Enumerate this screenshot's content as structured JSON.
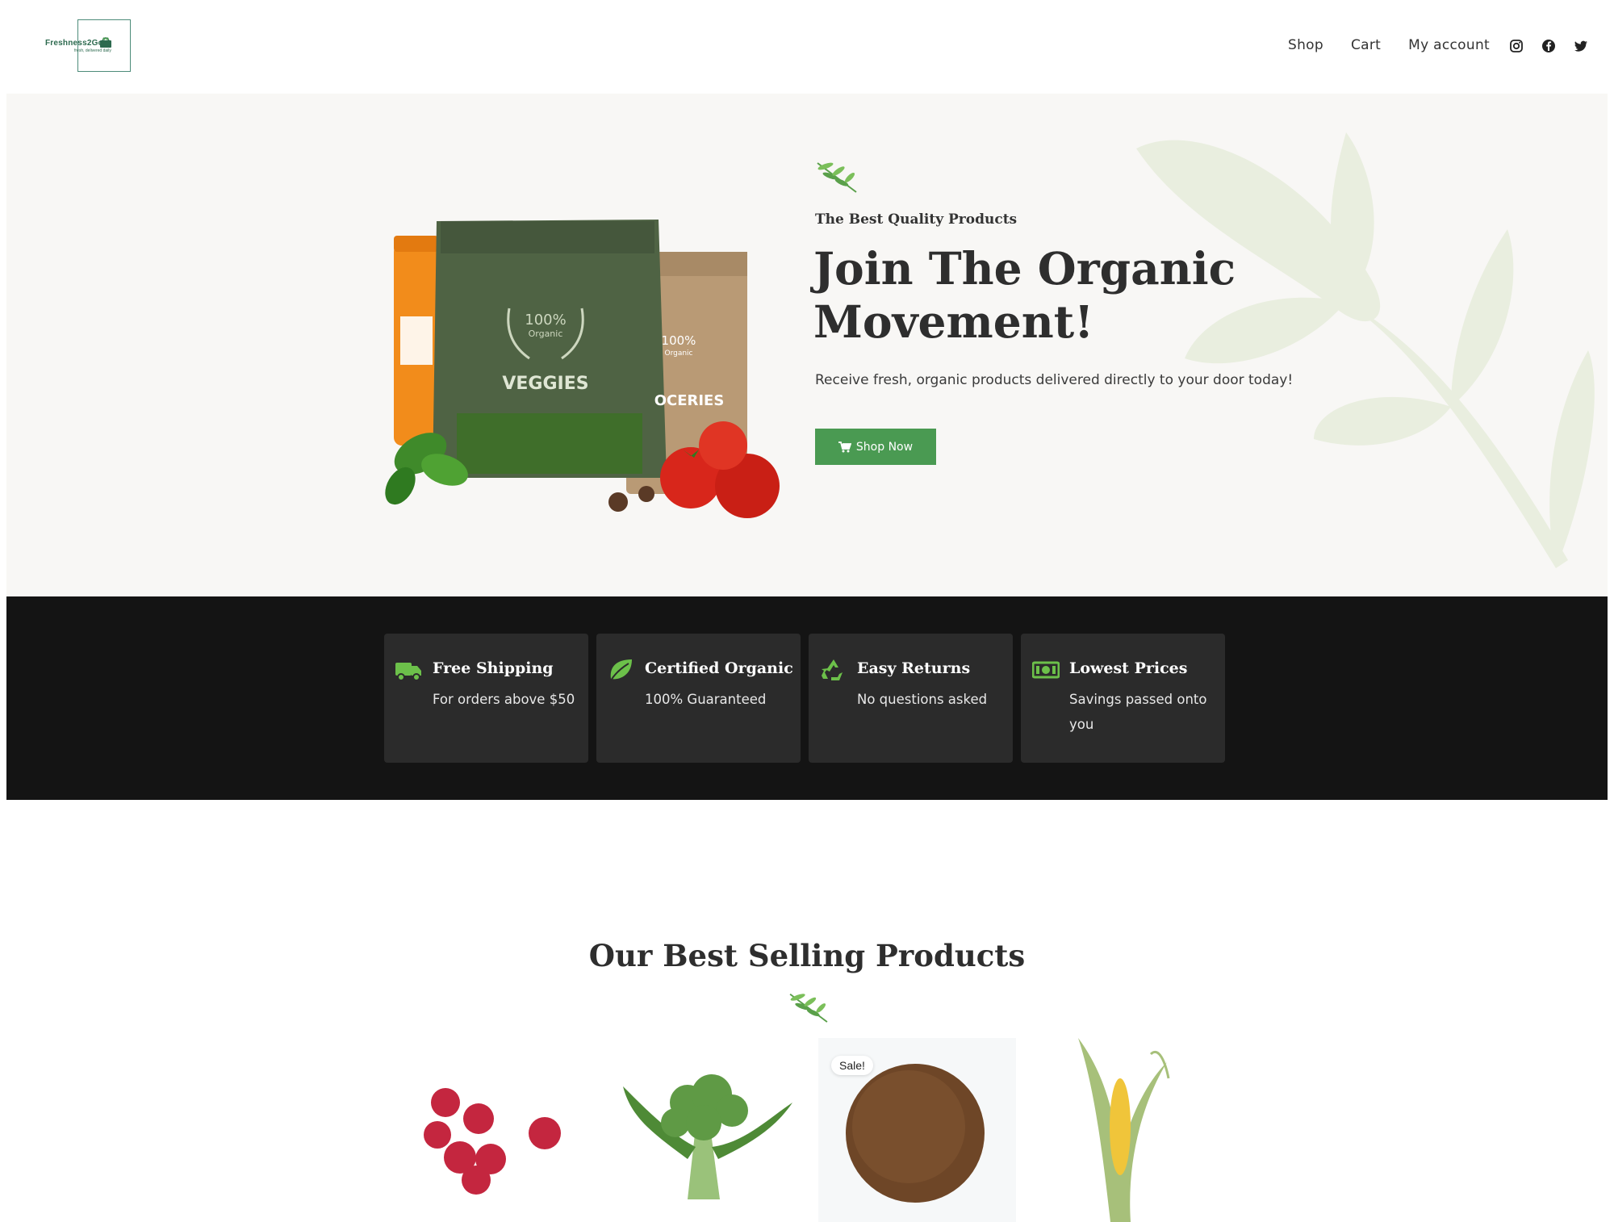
{
  "header": {
    "logo_text": "Freshness2Go",
    "logo_sub": "fresh, delivered daily",
    "nav": [
      {
        "label": "Shop"
      },
      {
        "label": "Cart"
      },
      {
        "label": "My account"
      }
    ],
    "social_icons": [
      "instagram-icon",
      "facebook-icon",
      "twitter-icon"
    ]
  },
  "hero": {
    "eyebrow": "The Best Quality Products",
    "title": "Join The Organic Movement!",
    "subtitle": "Receive fresh, organic products delivered directly to your door today!",
    "button_label": "Shop Now",
    "button_icon": "cart-icon",
    "accent_color": "#4a9a52",
    "bag_green_badge": "100%",
    "bag_green_badge_sub": "Organic",
    "bag_green_label": "VEGGIES",
    "bag_brown_badge": "100%",
    "bag_brown_badge_sub": "Organic",
    "bag_brown_label": "OCERIES"
  },
  "features": [
    {
      "icon": "truck-icon",
      "title": "Free Shipping",
      "subtitle": "For orders above $50"
    },
    {
      "icon": "leaf-icon",
      "title": "Certified Organic",
      "subtitle": "100% Guaranteed"
    },
    {
      "icon": "recycle-icon",
      "title": "Easy Returns",
      "subtitle": "No questions asked"
    },
    {
      "icon": "money-icon",
      "title": "Lowest Prices",
      "subtitle": "Savings passed onto you"
    }
  ],
  "best_sellers": {
    "title": "Our Best Selling Products",
    "products": [
      {
        "image": "raspberries",
        "sale": false
      },
      {
        "image": "broccoli",
        "sale": false
      },
      {
        "image": "coffee-beans",
        "sale": true
      },
      {
        "image": "corn",
        "sale": false
      }
    ],
    "sale_label": "Sale!"
  }
}
